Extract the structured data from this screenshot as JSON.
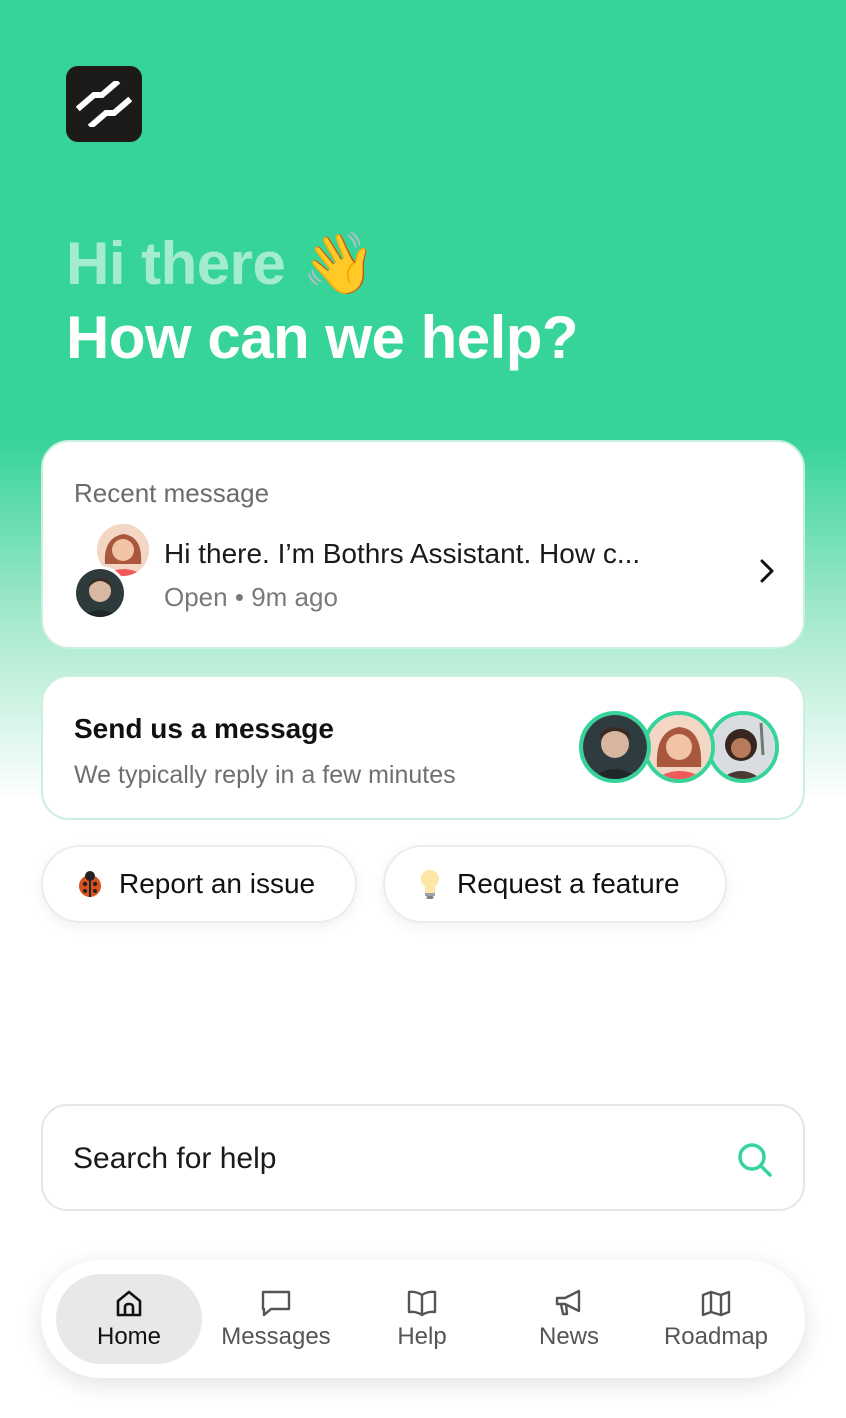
{
  "header": {
    "greeting": "Hi there",
    "greeting_emoji": "👋",
    "headline": "How can we help?"
  },
  "recent": {
    "label": "Recent message",
    "message": "Hi there. I’m Bothrs Assistant. How c...",
    "status": "Open",
    "separator": "•",
    "time": "9m ago"
  },
  "send": {
    "title": "Send us a message",
    "subtitle": "We typically reply in a few minutes"
  },
  "actions": [
    {
      "label": "Report an issue",
      "icon": "ladybug-icon"
    },
    {
      "label": "Request a feature",
      "icon": "lightbulb-icon"
    }
  ],
  "search": {
    "placeholder": "Search for help"
  },
  "nav": [
    {
      "label": "Home",
      "icon": "home-icon",
      "active": true
    },
    {
      "label": "Messages",
      "icon": "chat-icon",
      "active": false
    },
    {
      "label": "Help",
      "icon": "book-icon",
      "active": false
    },
    {
      "label": "News",
      "icon": "megaphone-icon",
      "active": false
    },
    {
      "label": "Roadmap",
      "icon": "map-icon",
      "active": false
    }
  ],
  "colors": {
    "brand": "#37d49a",
    "logo_bg": "#1d1a1a"
  }
}
